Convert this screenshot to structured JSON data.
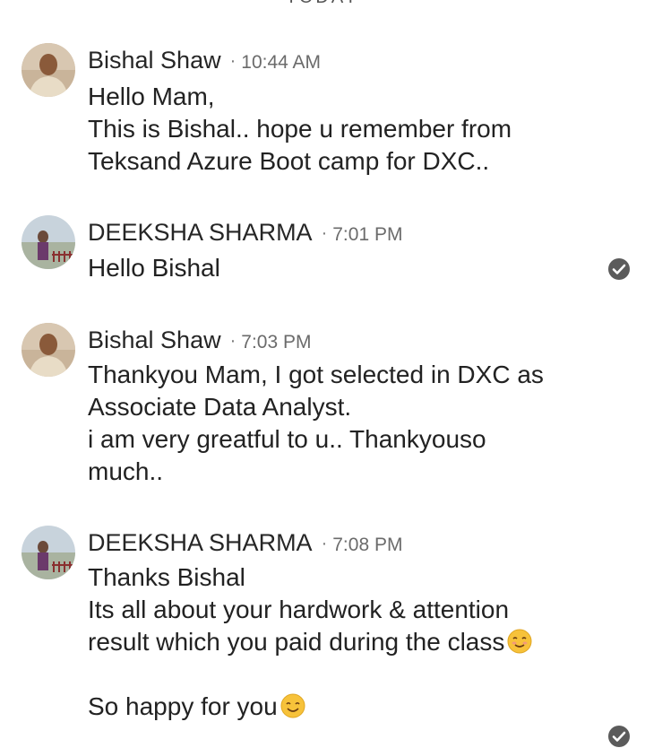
{
  "day_divider": "TODAY",
  "messages": [
    {
      "sender": "Bishal Shaw",
      "time": "10:44 AM",
      "lines": [
        "Hello Mam,",
        "This is Bishal.. hope u remember from",
        "Teksand Azure Boot camp for DXC.."
      ]
    },
    {
      "sender": "DEEKSHA SHARMA",
      "time": "7:01 PM",
      "lines": [
        "Hello Bishal"
      ]
    },
    {
      "sender": "Bishal Shaw",
      "time": "7:03 PM",
      "lines": [
        "Thankyou  Mam, I got selected in DXC as",
        "Associate Data Analyst.",
        "i am very greatful to u.. Thankyouso",
        "much.."
      ]
    },
    {
      "sender": "DEEKSHA SHARMA",
      "time": "7:08 PM",
      "lines": [
        "Thanks Bishal",
        "Its all about your hardwork & attention",
        "result which you paid during the class",
        "",
        "So happy for you"
      ]
    }
  ],
  "separator": "·",
  "icons": {
    "read_receipt": "check-circle-icon",
    "emoji_blush": "smiling-face-with-closed-eyes-emoji",
    "emoji_smile": "smiling-face-emoji"
  },
  "colors": {
    "read_receipt": "#5b5b5b",
    "emoji": "#f7c23a"
  }
}
